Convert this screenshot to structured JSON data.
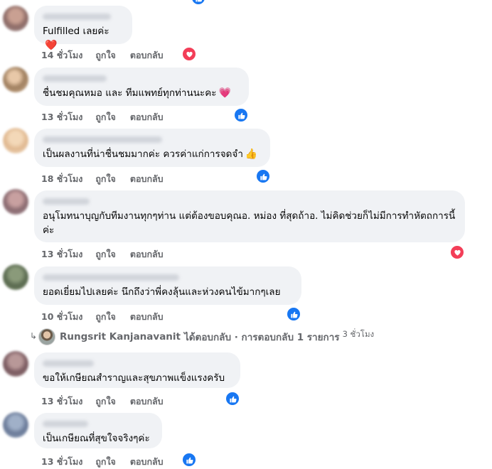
{
  "comments": [
    {
      "text": "Fulfilled เลยค่ะ",
      "emoji": "❤️",
      "time": "14 ชั่วโมง",
      "like": "ถูกใจ",
      "reply": "ตอบกลับ",
      "reaction": "heart"
    },
    {
      "text": "ชื่นชมคุณหมอ และ ทีมแพทย์ทุกท่านนะคะ",
      "emoji": "💗",
      "time": "13 ชั่วโมง",
      "like": "ถูกใจ",
      "reply": "ตอบกลับ",
      "reaction": "like"
    },
    {
      "text": "เป็นผลงานที่น่าชื่นชมมากค่ะ ควรค่าแก่การจดจำ",
      "emoji": "👍",
      "time": "18 ชั่วโมง",
      "like": "ถูกใจ",
      "reply": "ตอบกลับ",
      "reaction": "like"
    },
    {
      "text": "อนุโมทนาบุญกับทีมงานทุกๆท่าน แต่ต้องขอบคุณอ. หม่อง ที่สุดถ้าอ. ไม่คิดช่วยก็ไม่มีการทำหัตถการนี้ค่ะ",
      "emoji": "",
      "time": "13 ชั่วโมง",
      "like": "ถูกใจ",
      "reply": "ตอบกลับ",
      "reaction": "heart"
    },
    {
      "text": "ยอดเยี่ยมไปเลยค่ะ นึกถึงว่าพี่คงลุ้นและห่วงคนไข้มากๆเลย",
      "emoji": "",
      "time": "10 ชั่วโมง",
      "like": "ถูกใจ",
      "reply": "ตอบกลับ",
      "reaction": "like"
    },
    {
      "text": "ขอให้เกษียณสำราญและสุขภาพแข็งแรงครับ",
      "emoji": "",
      "time": "13 ชั่วโมง",
      "like": "ถูกใจ",
      "reply": "ตอบกลับ",
      "reaction": "like"
    },
    {
      "text": "เป็นเกษียณที่สุขใจจริงๆค่ะ",
      "emoji": "",
      "time": "13 ชั่วโมง",
      "like": "ถูกใจ",
      "reply": "ตอบกลับ",
      "reaction": "like"
    }
  ],
  "reply_summary": {
    "name": "Rungsrit Kanjanavanit",
    "text": "ได้ตอบกลับ · การตอบกลับ 1 รายการ",
    "time": "3 ชั่วโมง"
  },
  "colors": {
    "like": "#1877f2",
    "heart": "#f33e58",
    "bubble": "#f0f2f5",
    "meta": "#65676b"
  }
}
